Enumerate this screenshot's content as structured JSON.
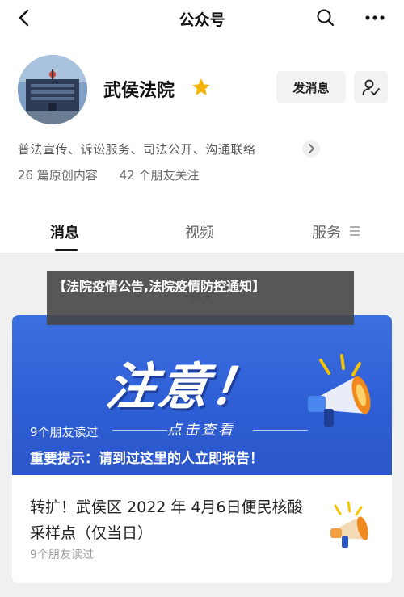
{
  "header": {
    "title": "公众号"
  },
  "profile": {
    "name": "武侯法院",
    "message_button": "发消息",
    "description": "普法宣传、诉讼服务、司法公开、沟通联络",
    "stats": {
      "articles": "26 篇原创内容",
      "friends": "42 个朋友关注"
    }
  },
  "tabs": [
    {
      "label": "消息"
    },
    {
      "label": "视频"
    },
    {
      "label": "服务"
    }
  ],
  "feed": {
    "date_label": "昨天",
    "overlay_banner": "【法院疫情公告,法院疫情防控通知】",
    "featured": {
      "cover_title": "注意！",
      "cover_subtitle": "点击查看",
      "readers": "9个朋友读过",
      "headline": "重要提示：请到过这里的人立即报告！"
    },
    "article": {
      "title": "转扩！武侯区 2022 年 4月6日便民核酸采样点（仅当日）",
      "readers": "9个朋友读过"
    }
  },
  "colors": {
    "brand_blue": "#3c6fe0",
    "star": "#f5b400",
    "accent_orange": "#f08a1e"
  },
  "icons": [
    "back-arrow-icon",
    "search-icon",
    "more-icon",
    "star-icon",
    "follow-user-icon",
    "chevron-right-icon",
    "menu-lines-icon",
    "megaphone-icon"
  ]
}
